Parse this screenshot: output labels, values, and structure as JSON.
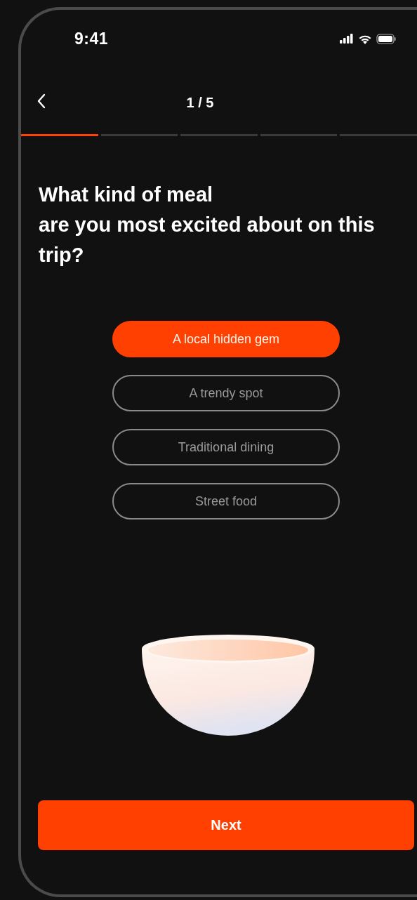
{
  "status_bar": {
    "time": "9:41"
  },
  "header": {
    "step": "1 / 5"
  },
  "progress": [
    {
      "filled": true
    },
    {
      "filled": false
    },
    {
      "filled": false
    },
    {
      "filled": false
    },
    {
      "filled": false
    }
  ],
  "question": "What kind of meal\nare you most excited about on this trip?",
  "options": [
    {
      "label": "A local hidden gem",
      "selected": true
    },
    {
      "label": "A trendy spot",
      "selected": false
    },
    {
      "label": "Traditional dining",
      "selected": false
    },
    {
      "label": "Street food",
      "selected": false
    }
  ],
  "button": {
    "label": "Next"
  }
}
